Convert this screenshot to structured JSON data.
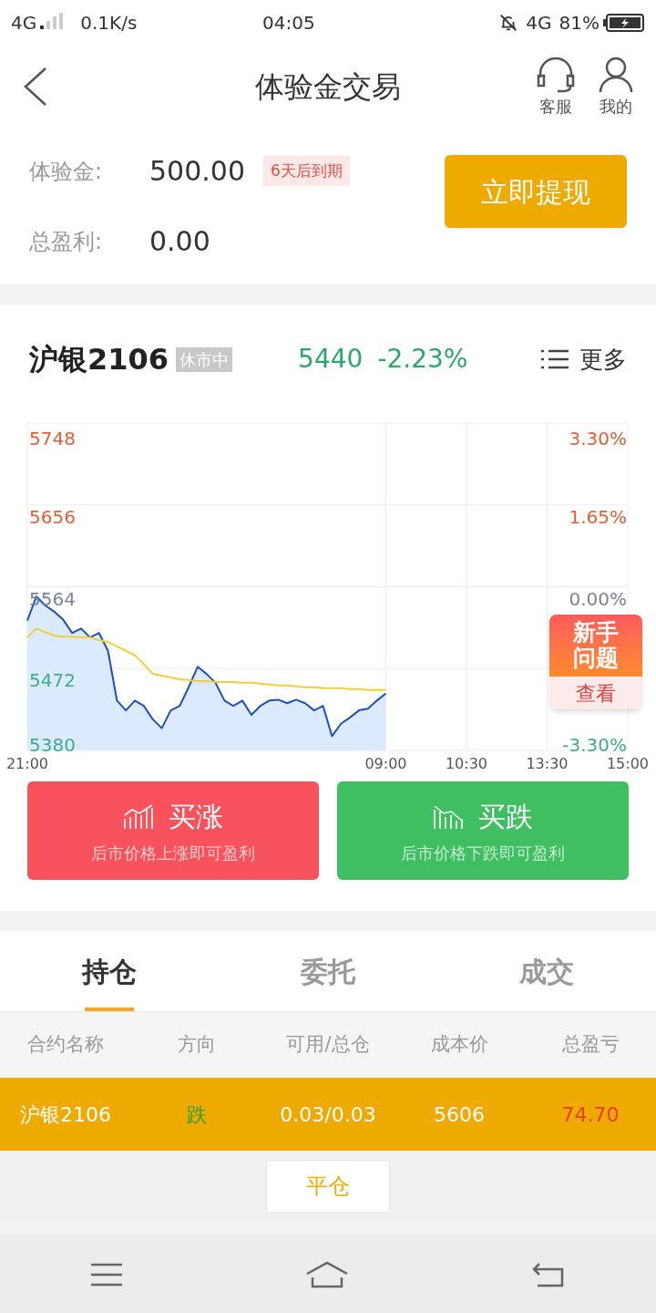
{
  "status_bar": {
    "network": "4G",
    "speed": "0.1K/s",
    "time": "04:05",
    "network_right": "4G",
    "battery": "81%"
  },
  "header": {
    "title": "体验金交易",
    "actions": [
      {
        "kind": "headset",
        "label": "客服"
      },
      {
        "kind": "user",
        "label": "我的"
      }
    ]
  },
  "account": {
    "rows": [
      {
        "label": "体验金:",
        "value": "500.00",
        "badge": "6天后到期"
      },
      {
        "label": "总盈利:",
        "value": "0.00"
      }
    ],
    "button": "立即提现"
  },
  "quote": {
    "name": "沪银2106",
    "status": "休市中",
    "price": "5440",
    "change": "-2.23%",
    "rising": false,
    "more": "更多",
    "chart_data": {
      "type": "line",
      "grid": true,
      "categories": [
        "21:00",
        null,
        null,
        null,
        null,
        null,
        null,
        null,
        null,
        null,
        null,
        null,
        null,
        null,
        null,
        null,
        null,
        null,
        null,
        null,
        null,
        null,
        null,
        null,
        null,
        null,
        null,
        null,
        null,
        null,
        null,
        null,
        null,
        null,
        null,
        null,
        null,
        null,
        null,
        null,
        "09:00",
        null,
        null,
        null,
        null,
        null,
        null,
        null,
        null,
        "10:30",
        null,
        null,
        null,
        null,
        null,
        null,
        null,
        null,
        "13:30",
        null,
        null,
        null,
        null,
        null,
        null,
        null,
        null,
        "15:00"
      ],
      "series": [
        {
          "color": "#1f4fbf",
          "values": [
            5526,
            5553,
            5543,
            5536,
            5527,
            5512,
            5517,
            5507,
            5512,
            5492,
            5436,
            5425,
            5436,
            5430,
            5415,
            5405,
            5425,
            5430,
            5451,
            5474,
            5466,
            5456,
            5436,
            5430,
            5436,
            5420,
            5430,
            5436,
            5437,
            5433,
            5437,
            5433,
            5425,
            5430,
            5396,
            5410,
            5417,
            5425,
            5427,
            5436,
            5444,
            null,
            null,
            null,
            null,
            null,
            null,
            null,
            null,
            null,
            null,
            null,
            null,
            null,
            null,
            null,
            null,
            null,
            null,
            null,
            null,
            null,
            null,
            null,
            null,
            null,
            null,
            null
          ]
        },
        {
          "color": "#f2cf3a",
          "values": [
            5507,
            5517,
            5513,
            5509,
            5508,
            5508,
            5507,
            5507,
            5504,
            5502,
            5497,
            5492,
            5487,
            5477,
            5466,
            5464,
            5462,
            5460,
            5459,
            5458,
            5458,
            5457,
            5457,
            5457,
            5456,
            5456,
            5455,
            5454,
            5453,
            5453,
            5452,
            5451,
            5451,
            5450,
            5450,
            5450,
            5449,
            5449,
            5448,
            5448,
            5448,
            null,
            null,
            null,
            null,
            null,
            null,
            null,
            null,
            null,
            null,
            null,
            null,
            null,
            null,
            null,
            null,
            null,
            null,
            null,
            null,
            null,
            null,
            null,
            null,
            null,
            null,
            null
          ]
        }
      ],
      "ylim": [
        5380,
        5748
      ],
      "yticks": [
        {
          "value": 5748,
          "label": "5748"
        },
        {
          "value": 5656,
          "label": "5656"
        },
        {
          "value": 5564,
          "label": "5564"
        },
        {
          "value": 5472,
          "label": "5472"
        },
        {
          "value": 5380,
          "label": "5380"
        }
      ],
      "annotations": [
        "3.30%",
        "1.65%",
        "0.00%",
        "-3.30%"
      ]
    },
    "badge": {
      "title": "新手问题",
      "action": "查看"
    }
  },
  "trade_buttons": [
    {
      "kind": "up",
      "label": "买涨",
      "hint": "后市价格上涨即可盈利"
    },
    {
      "kind": "down",
      "label": "买跌",
      "hint": "后市价格下跌即可盈利"
    }
  ],
  "positions": {
    "tabs": [
      {
        "label": "持仓",
        "selected": true
      },
      {
        "label": "委托",
        "selected": false
      },
      {
        "label": "成交",
        "selected": false
      }
    ],
    "columns": [
      "合约名称",
      "方向",
      "可用/总仓",
      "成本价",
      "总盈亏"
    ],
    "rows": [
      {
        "contract": "沪银2106",
        "direction": {
          "text": "跌",
          "kind": "down"
        },
        "quantity": "0.03/0.03",
        "cost": "5606",
        "pnl": {
          "text": "74.70",
          "kind": "profit"
        }
      }
    ],
    "close_button": "平仓"
  }
}
